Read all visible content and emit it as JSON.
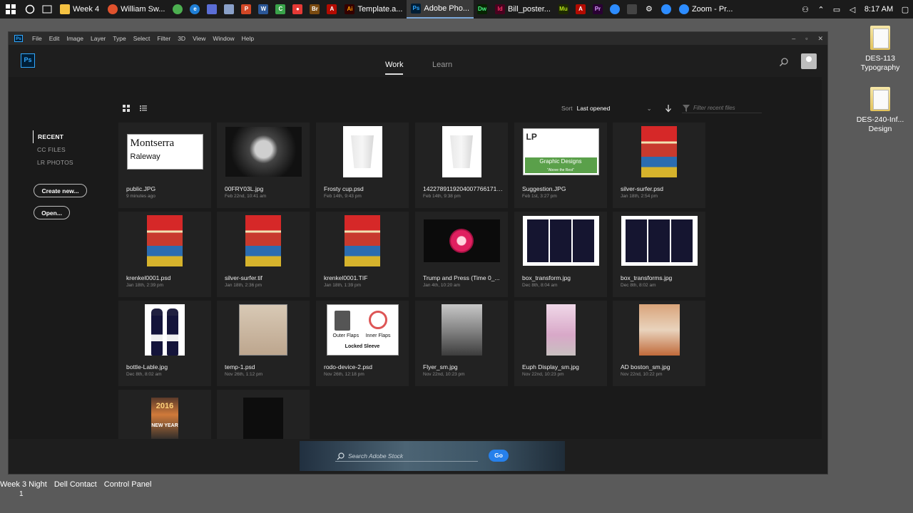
{
  "taskbar": {
    "items": [
      {
        "label": "Week 4",
        "color": "#f5c242"
      },
      {
        "label": "William Sw...",
        "color": "#e0522d"
      },
      {
        "label": "Template.a...",
        "color": "#ff7c00"
      },
      {
        "label": "Adobe Pho...",
        "color": "#31a8ff"
      },
      {
        "label": "Bill_poster...",
        "color": "#ff3366"
      },
      {
        "label": "Zoom - Pr...",
        "color": "#2d8cff"
      }
    ],
    "clock": "8:17 AM"
  },
  "desktop": {
    "icons": [
      {
        "label": "DES-113 Typography"
      },
      {
        "label": "DES-240-Inf... Design"
      }
    ],
    "bottom_labels": [
      "Week 3 Night",
      "Dell Contact",
      "Control Panel"
    ],
    "bottom_number": "1"
  },
  "menu": {
    "items": [
      "File",
      "Edit",
      "Image",
      "Layer",
      "Type",
      "Select",
      "Filter",
      "3D",
      "View",
      "Window",
      "Help"
    ]
  },
  "header": {
    "logo": "Ps",
    "tabs": {
      "work": "Work",
      "learn": "Learn"
    }
  },
  "sidebar": {
    "items": [
      "RECENT",
      "CC FILES",
      "LR PHOTOS"
    ],
    "create_label": "Create new...",
    "open_label": "Open..."
  },
  "toolbar": {
    "sort_label": "Sort",
    "sort_value": "Last opened",
    "filter_placeholder": "Filter recent files"
  },
  "files": [
    {
      "name": "public.JPG",
      "date": "9 minutes ago",
      "thumb": "public",
      "thumb_text": [
        "Montserra",
        "Raleway"
      ]
    },
    {
      "name": "00FRY03L.jpg",
      "date": "Feb 22nd, 10:41 am",
      "thumb": "face"
    },
    {
      "name": "Frosty cup.psd",
      "date": "Feb 14th, 9:43 pm",
      "thumb": "cup"
    },
    {
      "name": "1422789119204007766171q...",
      "date": "Feb 14th, 9:38 pm",
      "thumb": "cup"
    },
    {
      "name": "Suggestion.JPG",
      "date": "Feb 1st, 3:27 pm",
      "thumb": "lp",
      "thumb_text": [
        "LP",
        "Graphic Designs",
        "\"Above the Rest\""
      ]
    },
    {
      "name": "silver-surfer.psd",
      "date": "Jan 18th, 2:54 pm",
      "thumb": "comic"
    },
    {
      "name": "krenkel0001.psd",
      "date": "Jan 18th, 2:39 pm",
      "thumb": "comic"
    },
    {
      "name": "silver-surfer.tif",
      "date": "Jan 18th, 2:36 pm",
      "thumb": "comic"
    },
    {
      "name": "krenkel0001.TIF",
      "date": "Jan 18th, 1:39 pm",
      "thumb": "comic"
    },
    {
      "name": "Trump and Press (Time 0_...",
      "date": "Jan 4th, 10:20 am",
      "thumb": "trump"
    },
    {
      "name": "box_transform.jpg",
      "date": "Dec 8th, 8:04 am",
      "thumb": "box"
    },
    {
      "name": "box_transforms.jpg",
      "date": "Dec 8th, 8:02 am",
      "thumb": "box"
    },
    {
      "name": "bottle-Lable.jpg",
      "date": "Dec 8th, 8:02 am",
      "thumb": "bottle"
    },
    {
      "name": "temp-1.psd",
      "date": "Nov 26th, 1:12 pm",
      "thumb": "temp"
    },
    {
      "name": "rodo-device-2.psd",
      "date": "Nov 26th, 12:18 pm",
      "thumb": "rodo",
      "thumb_text": [
        "Outer Flaps",
        "Inner Flaps",
        "Locked Sleeve"
      ]
    },
    {
      "name": "Flyer_sm.jpg",
      "date": "Nov 22nd, 10:23 pm",
      "thumb": "flyer"
    },
    {
      "name": "Euph Display_sm.jpg",
      "date": "Nov 22nd, 10:23 pm",
      "thumb": "euph"
    },
    {
      "name": "AD boston_sm.jpg",
      "date": "Nov 22nd, 10:22 pm",
      "thumb": "adb"
    },
    {
      "name": "",
      "date": "",
      "thumb": "ny",
      "thumb_text": [
        "2016",
        "NEW YEAR"
      ]
    },
    {
      "name": "",
      "date": "",
      "thumb": "hops"
    }
  ],
  "stock": {
    "placeholder": "Search Adobe Stock",
    "go_label": "Go"
  }
}
